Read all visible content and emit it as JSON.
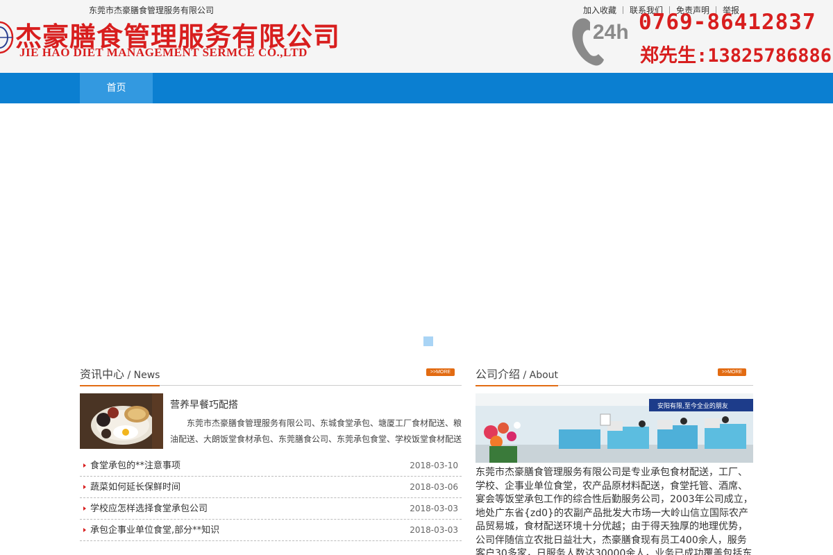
{
  "header": {
    "slogan": "东莞市杰豪膳食管理服务有限公司",
    "logo_cn": "杰豪膳食管理服务有限公司",
    "logo_en": "JIE HAO DIET MANAGEMENT SERMCE CO.,LTD",
    "top_links": [
      "加入收藏",
      "联系我们",
      "免责声明",
      "举报"
    ],
    "phone_badge": "24h",
    "phone_main": "0769-86412837",
    "phone_contact": "郑先生:13825786886"
  },
  "nav": {
    "items": [
      "首页"
    ]
  },
  "news": {
    "title_cn": "资讯中心",
    "title_en": " / News",
    "more_label": ">>MORE",
    "featured": {
      "title": "营养早餐巧配搭",
      "desc": "东莞市杰豪膳食管理服务有限公司、东城食堂承包、塘厦工厂食材配送、粮油配送、大朗饭堂食材承包、东莞膳食公司、东莞承包食堂、学校饭堂食材配送"
    },
    "items": [
      {
        "title": "食堂承包的**注意事项",
        "date": "2018-03-10"
      },
      {
        "title": "蔬菜如何延长保鲜时间",
        "date": "2018-03-06"
      },
      {
        "title": "学校应怎样选择食堂承包公司",
        "date": "2018-03-03"
      },
      {
        "title": "承包企事业单位食堂,部分**知识",
        "date": "2018-03-03"
      }
    ]
  },
  "about": {
    "title_cn": "公司介绍",
    "title_en": " / About",
    "more_label": ">>MORE",
    "office_sign": "安阳有限,至今全业的朋友",
    "text": "东莞市杰豪膳食管理服务有限公司是专业承包食材配送，工厂、学校、企事业单位食堂，农产品原材料配送，食堂托管、酒席、宴会等饭堂承包工作的综合性后勤服务公司，2003年公司成立，地处广东省{zd0}的农副产品批发大市场一大岭山信立国际农产品贸易城，食材配送环境十分优越；由于得天独厚的地理优势，公司伴随信立农批日益壮大，杰豪膳食现有员工400余人，服务客户30多家，日服务人数达30000余人，业务已成功覆盖包括东"
  }
}
